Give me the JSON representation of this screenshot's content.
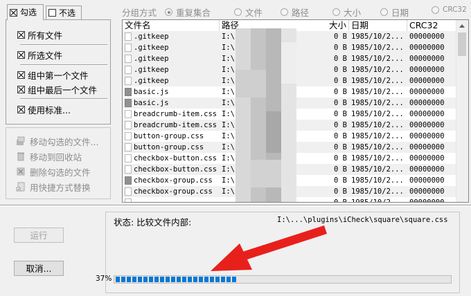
{
  "tabs": [
    {
      "label": "勾选",
      "checked": true,
      "active": true
    },
    {
      "label": "不选",
      "checked": false,
      "active": false
    }
  ],
  "check_options": [
    {
      "label": "所有文件",
      "checked": true
    },
    {
      "label": "所选文件",
      "checked": true
    },
    {
      "label": "组中第一个文件",
      "checked": true
    },
    {
      "label": "组中最后一个文件",
      "checked": true
    },
    {
      "label": "使用标准...",
      "checked": true
    }
  ],
  "actions": [
    {
      "label": "移动勾选的文件...",
      "icon": "move-files-icon"
    },
    {
      "label": "移动到回收站",
      "icon": "recycle-bin-icon"
    },
    {
      "label": "删除勾选的文件",
      "icon": "delete-icon"
    },
    {
      "label": "用快捷方式替换",
      "icon": "shortcut-icon"
    }
  ],
  "group_by": {
    "label": "分组方式",
    "options": [
      {
        "label": "重复集合",
        "selected": true
      },
      {
        "label": "文件",
        "selected": false
      },
      {
        "label": "路径",
        "selected": false
      },
      {
        "label": "大小",
        "selected": false
      },
      {
        "label": "日期",
        "selected": false
      },
      {
        "label": "CRC32",
        "selected": false
      }
    ]
  },
  "table": {
    "columns": [
      "文件名",
      "路径",
      "大小",
      "日期",
      "CRC32"
    ],
    "rows": [
      {
        "name": ".gitkeep",
        "path": "I:\\",
        "size": "0 B",
        "date": "1985/10/2...",
        "crc": "00000000",
        "icon": "blank"
      },
      {
        "name": ".gitkeep",
        "path": "I:\\",
        "size": "0 B",
        "date": "1985/10/2...",
        "crc": "00000000",
        "icon": "blank"
      },
      {
        "name": ".gitkeep",
        "path": "I:\\",
        "size": "0 B",
        "date": "1985/10/2...",
        "crc": "00000000",
        "icon": "blank"
      },
      {
        "name": ".gitkeep",
        "path": "I:\\",
        "size": "0 B",
        "date": "1985/10/2...",
        "crc": "00000000",
        "icon": "blank"
      },
      {
        "name": ".gitkeep",
        "path": "I:\\",
        "size": "0 B",
        "date": "1985/10/2...",
        "crc": "00000000",
        "icon": "blank"
      },
      {
        "name": "basic.js",
        "path": "I:\\",
        "size": "0 B",
        "date": "1985/10/2...",
        "crc": "00000000",
        "icon": "dark"
      },
      {
        "name": "basic.js",
        "path": "I:\\",
        "size": "0 B",
        "date": "1985/10/2...",
        "crc": "00000000",
        "icon": "dark"
      },
      {
        "name": "breadcrumb-item.css",
        "path": "I:\\",
        "size": "0 B",
        "date": "1985/10/2...",
        "crc": "00000000",
        "icon": "blank"
      },
      {
        "name": "breadcrumb-item.css",
        "path": "I:\\",
        "size": "0 B",
        "date": "1985/10/2...",
        "crc": "00000000",
        "icon": "blank"
      },
      {
        "name": "button-group.css",
        "path": "I:\\",
        "size": "0 B",
        "date": "1985/10/2...",
        "crc": "00000000",
        "icon": "blank"
      },
      {
        "name": "button-group.css",
        "path": "I:\\",
        "size": "0 B",
        "date": "1985/10/2...",
        "crc": "00000000",
        "icon": "blank"
      },
      {
        "name": "checkbox-button.css",
        "path": "I:\\",
        "size": "0 B",
        "date": "1985/10/2...",
        "crc": "00000000",
        "icon": "blank"
      },
      {
        "name": "checkbox-button.css",
        "path": "I:\\",
        "size": "0 B",
        "date": "1985/10/2...",
        "crc": "00000000",
        "icon": "blank"
      },
      {
        "name": "checkbox-group.css",
        "path": "I:\\",
        "size": "0 B",
        "date": "1985/10/2...",
        "crc": "00000000",
        "icon": "dark"
      },
      {
        "name": "checkbox-group.css",
        "path": "I:\\",
        "size": "0 B",
        "date": "1985/10/2...",
        "crc": "00000000",
        "icon": "blank"
      },
      {
        "name": "...",
        "path": "...",
        "size": "0 B",
        "date": "1985/10/2...",
        "crc": "00000000",
        "icon": "blank"
      }
    ]
  },
  "status": {
    "label": "状态: 比较文件内部:",
    "path": "I:\\...\\plugins\\iCheck\\square\\square.css"
  },
  "progress": {
    "percent_label": "37%",
    "value": 0.37
  },
  "buttons": {
    "run": "运行",
    "cancel": "取消..."
  },
  "colors": {
    "progress": "#0678d4",
    "annotation_arrow": "#e8201c"
  }
}
